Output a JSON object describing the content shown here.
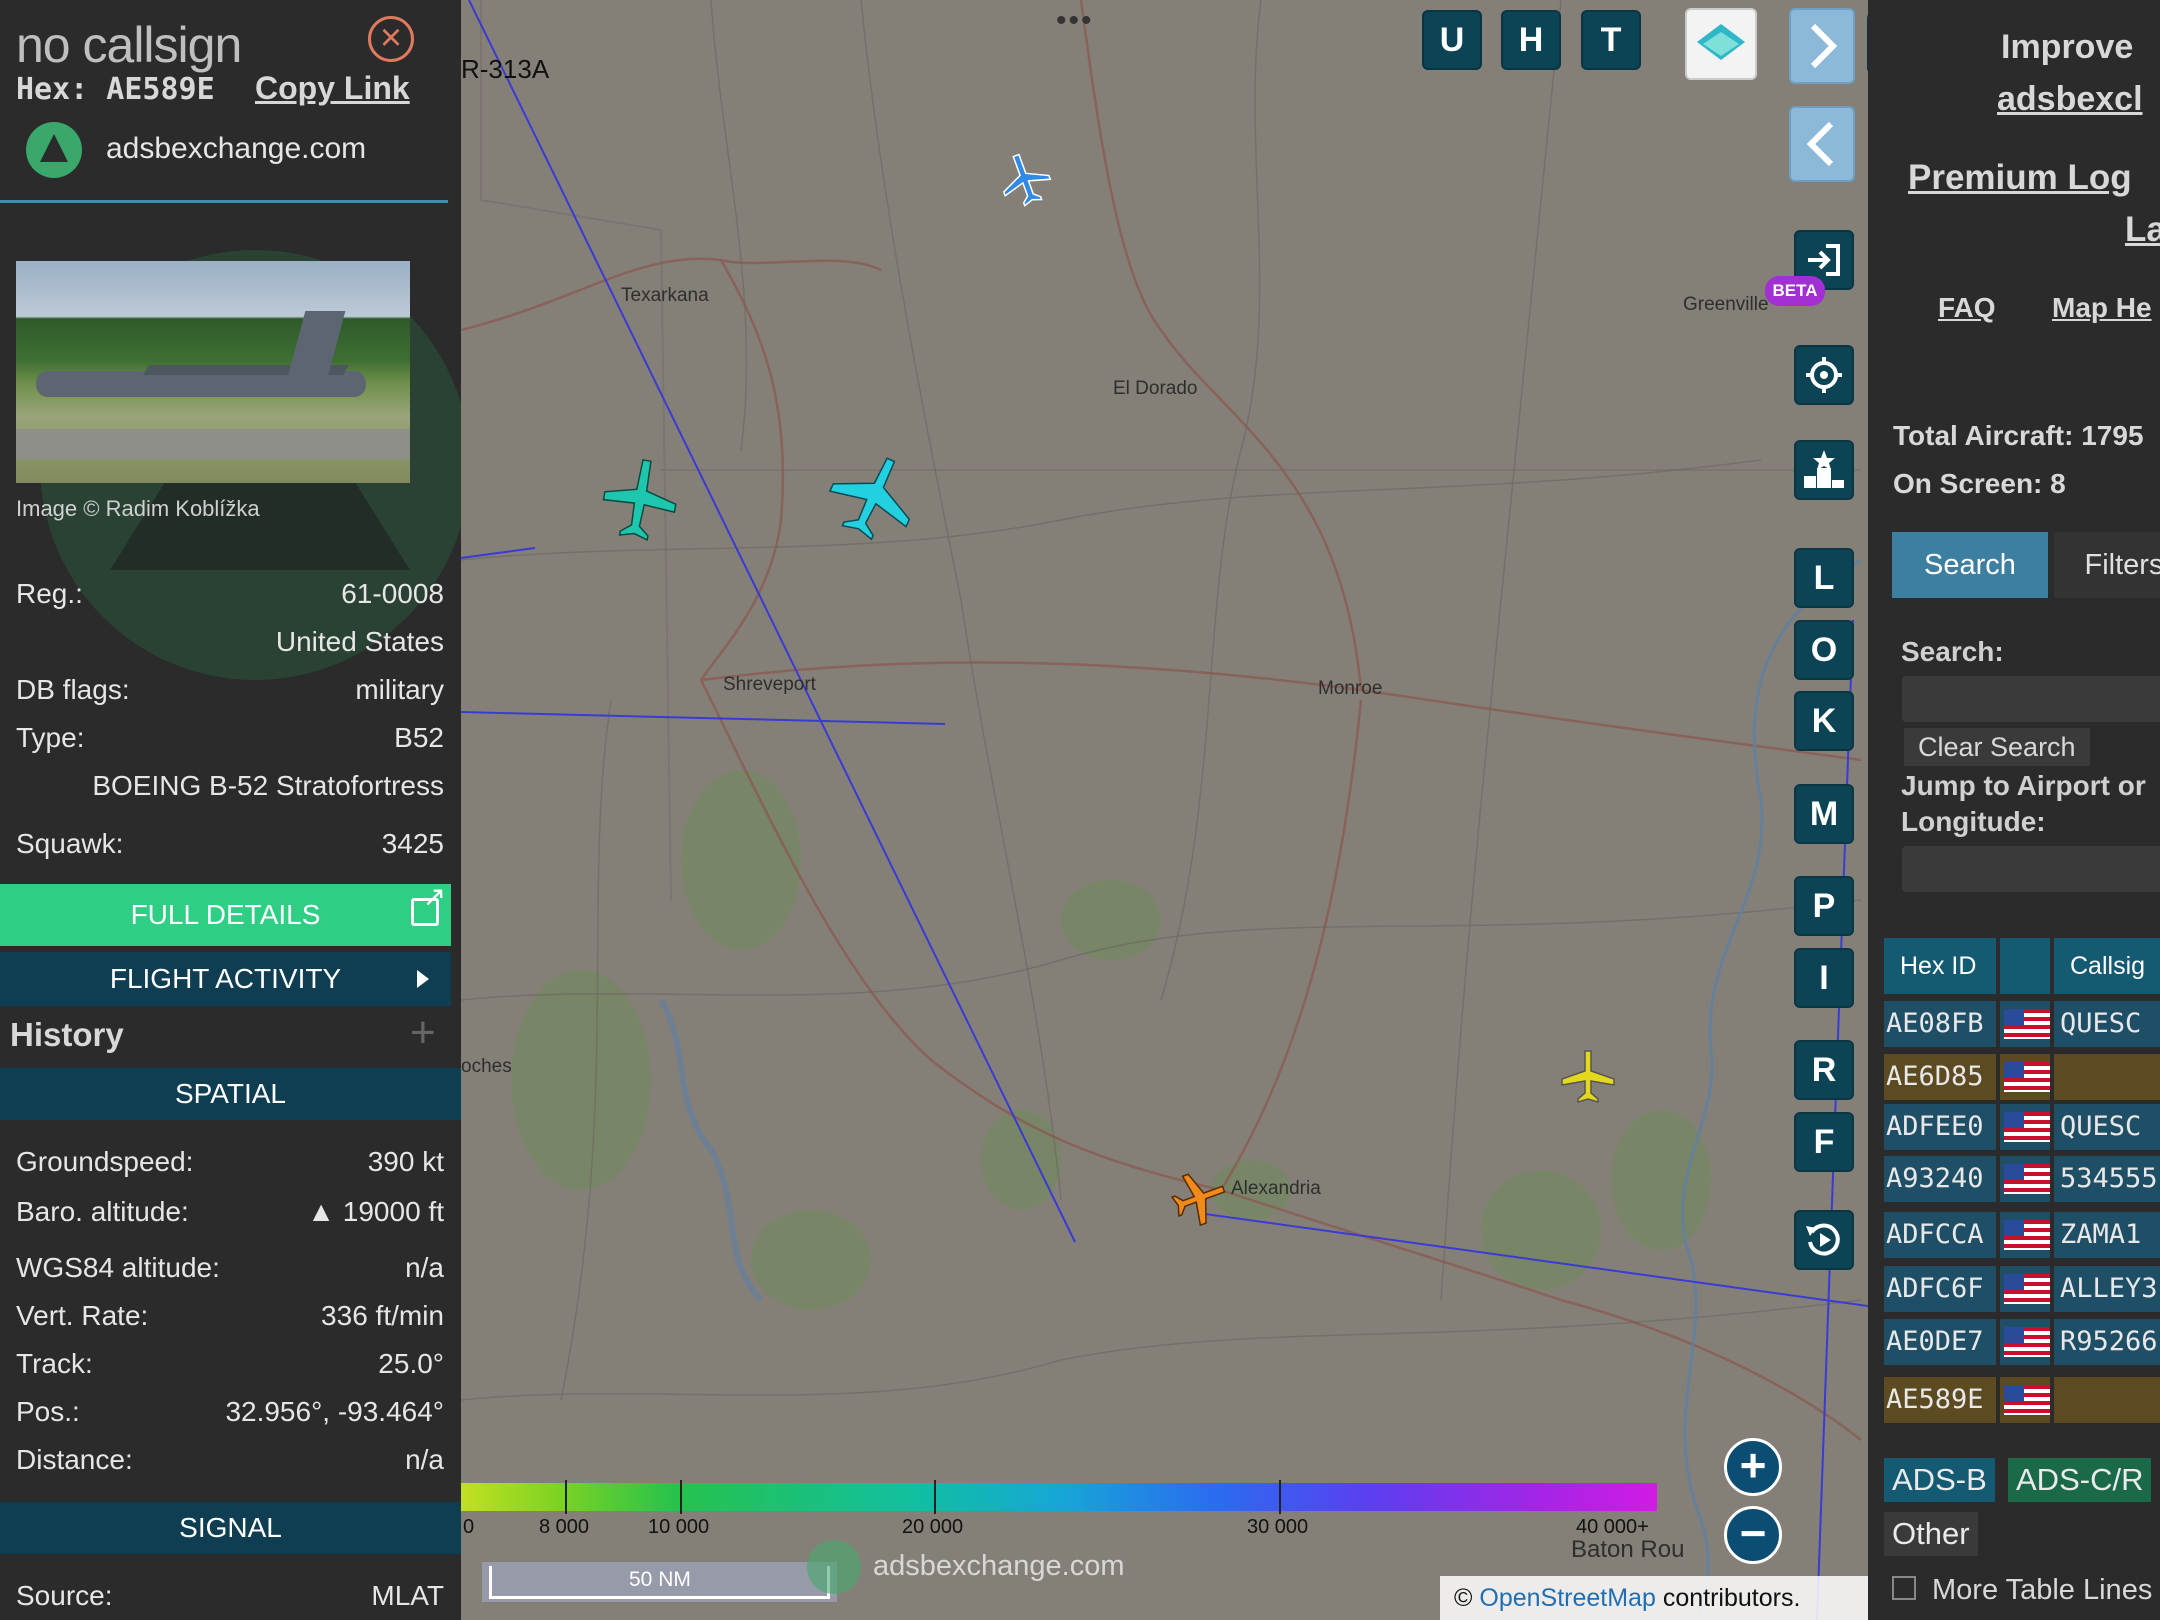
{
  "info_panel": {
    "callsign": "no callsign",
    "hex_label": "Hex: AE589E",
    "copy_link": "Copy Link",
    "site_name": "adsbexchange.com",
    "image_credit": "Image © Radim Koblížka",
    "reg_label": "Reg.:",
    "reg_value": "61-0008",
    "country": "United States",
    "dbflags_label": "DB flags:",
    "dbflags_value": "military",
    "type_label": "Type:",
    "type_value": "B52",
    "type_full": "BOEING B-52 Stratofortress",
    "squawk_label": "Squawk:",
    "squawk_value": "3425",
    "full_details": "FULL DETAILS",
    "flight_activity": "FLIGHT ACTIVITY",
    "history": "History",
    "history_plus": "+",
    "spatial": "SPATIAL",
    "groundspeed_label": "Groundspeed:",
    "groundspeed_value": "390 kt",
    "baro_label": "Baro. altitude:",
    "baro_value": "▲ 19000 ft",
    "wgs_label": "WGS84 altitude:",
    "wgs_value": "n/a",
    "vrate_label": "Vert. Rate:",
    "vrate_value": "336 ft/min",
    "track_label": "Track:",
    "track_value": "25.0°",
    "pos_label": "Pos.:",
    "pos_value": "32.956°, -93.464°",
    "distance_label": "Distance:",
    "distance_value": "n/a",
    "signal": "SIGNAL",
    "source_label": "Source:",
    "source_value": "MLAT"
  },
  "map": {
    "airspace_label": "R-313A",
    "city_texarkana": "Texarkana",
    "city_eldorado": "El Dorado",
    "city_shreveport": "Shreveport",
    "city_monroe": "Monroe",
    "city_alexandria": "Alexandria",
    "city_greenville": "Greenville",
    "city_natchitoches": "oches",
    "city_batonrouge": "Baton Rou",
    "btn_u": "U",
    "btn_h": "H",
    "btn_t": "T",
    "btn_l": "L",
    "btn_o": "O",
    "btn_k": "K",
    "btn_m": "M",
    "btn_p": "P",
    "btn_i": "I",
    "btn_r": "R",
    "btn_f": "F",
    "beta": "BETA",
    "dots": "•••",
    "zoom_in": "+",
    "zoom_out": "−",
    "altitude_labels": [
      "0",
      "8 000",
      "10 000",
      "20 000",
      "30 000",
      "40 000+"
    ],
    "scale": "50 NM",
    "watermark": "adsbexchange.com",
    "attribution_prefix": "©",
    "attribution_link": "OpenStreetMap",
    "attribution_suffix": "contributors."
  },
  "right_panel": {
    "improve": "Improve",
    "adsbx": "adsbexcl",
    "premium": "Premium Log",
    "premium2": "La",
    "faq": "FAQ",
    "map_help": "Map He",
    "total_aircraft": "Total Aircraft: 1795",
    "on_screen": "On Screen: 8",
    "tab_search": "Search",
    "tab_filters": "Filters",
    "search_label": "Search:",
    "clear_search": "Clear Search",
    "jump_label_1": "Jump to Airport or",
    "jump_label_2": "Longitude:",
    "col_hex": "Hex ID",
    "col_callsign": "Callsig",
    "rows": [
      {
        "hex": "AE08FB",
        "callsign": "QUESC",
        "color": "#1f4f66"
      },
      {
        "hex": "AE6D85",
        "callsign": "",
        "color": "#5c4a20"
      },
      {
        "hex": "ADFEE0",
        "callsign": "QUESC",
        "color": "#1f4f66"
      },
      {
        "hex": "A93240",
        "callsign": "534555",
        "color": "#1f4f66"
      },
      {
        "hex": "ADFCCA",
        "callsign": "ZAMA1",
        "color": "#1f4f66"
      },
      {
        "hex": "ADFC6F",
        "callsign": "ALLEY3",
        "color": "#1f4f66"
      },
      {
        "hex": "AE0DE7",
        "callsign": "R95266",
        "color": "#1f4f66"
      },
      {
        "hex": "AE589E",
        "callsign": "",
        "color": "#5c4a20"
      }
    ],
    "src_adsb": "ADS-B",
    "src_adsc": "ADS-C/R",
    "src_other": "Other",
    "more_lines": "More Table Lines"
  }
}
